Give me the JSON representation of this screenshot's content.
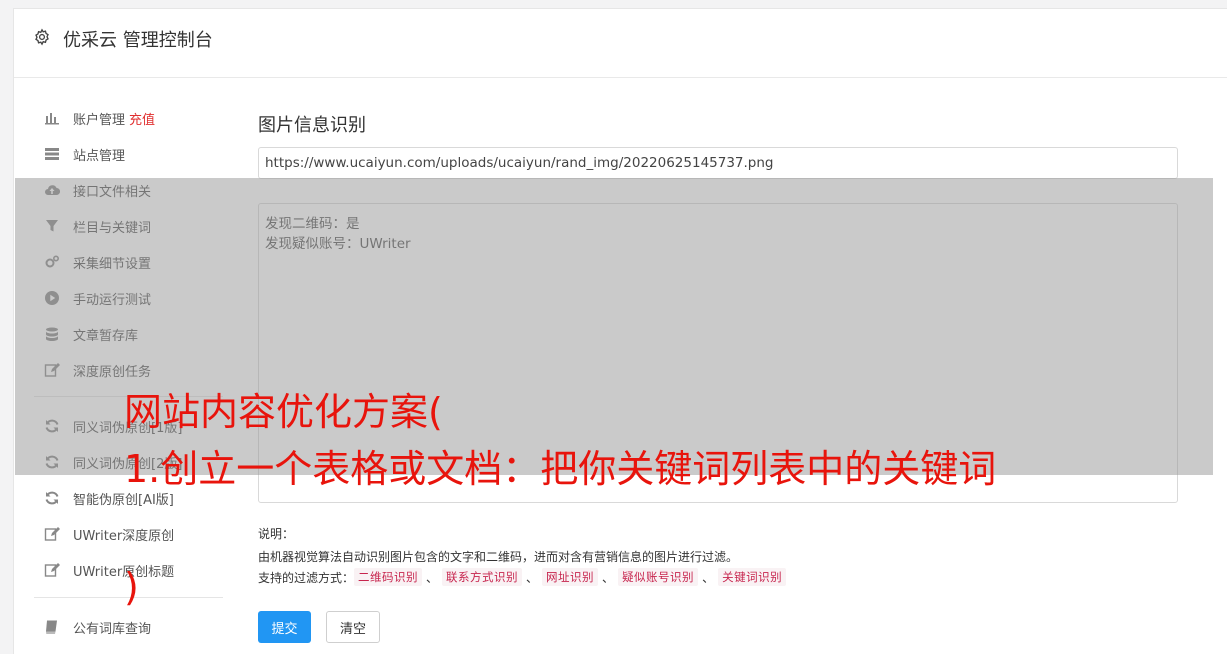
{
  "header": {
    "title": "优采云 管理控制台",
    "icon": "gear-icon"
  },
  "sidebar": {
    "items": [
      {
        "label": "账户管理",
        "extra": "充值",
        "icon": "bar-chart-icon"
      },
      {
        "label": "站点管理",
        "icon": "server-icon"
      },
      {
        "label": "接口文件相关",
        "icon": "cloud-upload-icon"
      },
      {
        "label": "栏目与关键词",
        "icon": "filter-icon"
      },
      {
        "label": "采集细节设置",
        "icon": "gears-icon"
      },
      {
        "label": "手动运行测试",
        "icon": "play-circle-icon"
      },
      {
        "label": "文章暂存库",
        "icon": "database-icon"
      },
      {
        "label": "深度原创任务",
        "icon": "edit-icon"
      },
      {
        "label": "同义词伪原创[1版]",
        "icon": "refresh-icon"
      },
      {
        "label": "同义词伪原创[2版]",
        "icon": "refresh-icon"
      },
      {
        "label": "智能伪原创[AI版]",
        "icon": "refresh-icon"
      },
      {
        "label": "UWriter深度原创",
        "icon": "edit-icon"
      },
      {
        "label": "UWriter原创标题",
        "icon": "edit-icon"
      },
      {
        "label": "公有词库查询",
        "icon": "book-icon"
      }
    ]
  },
  "main": {
    "title": "图片信息识别",
    "url_value": "https://www.ucaiyun.com/uploads/ucaiyun/rand_img/20220625145737.png",
    "results": [
      "发现二维码：是",
      "发现疑似账号：UWriter"
    ],
    "note_label": "说明：",
    "note_text": "由机器视觉算法自动识别图片包含的文字和二维码，进而对含有营销信息的图片进行过滤。",
    "filter_label": "支持的过滤方式：",
    "filter_tags": [
      "二维码识别",
      "联系方式识别",
      "网址识别",
      "疑似账号识别",
      "关键词识别"
    ],
    "filter_sep": "、",
    "submit_label": "提交",
    "clear_label": "清空"
  },
  "overlay": {
    "lines": [
      "网站内容优化方案(",
      "1.创立一个表格或文档：把你关键词列表中的关键词",
      ")"
    ]
  },
  "colors": {
    "accent": "#2196f3",
    "recharge": "#e02f2f",
    "overlay_text": "#e8140c",
    "tag_text": "#c7254e",
    "tag_bg": "#f9f2f4"
  }
}
